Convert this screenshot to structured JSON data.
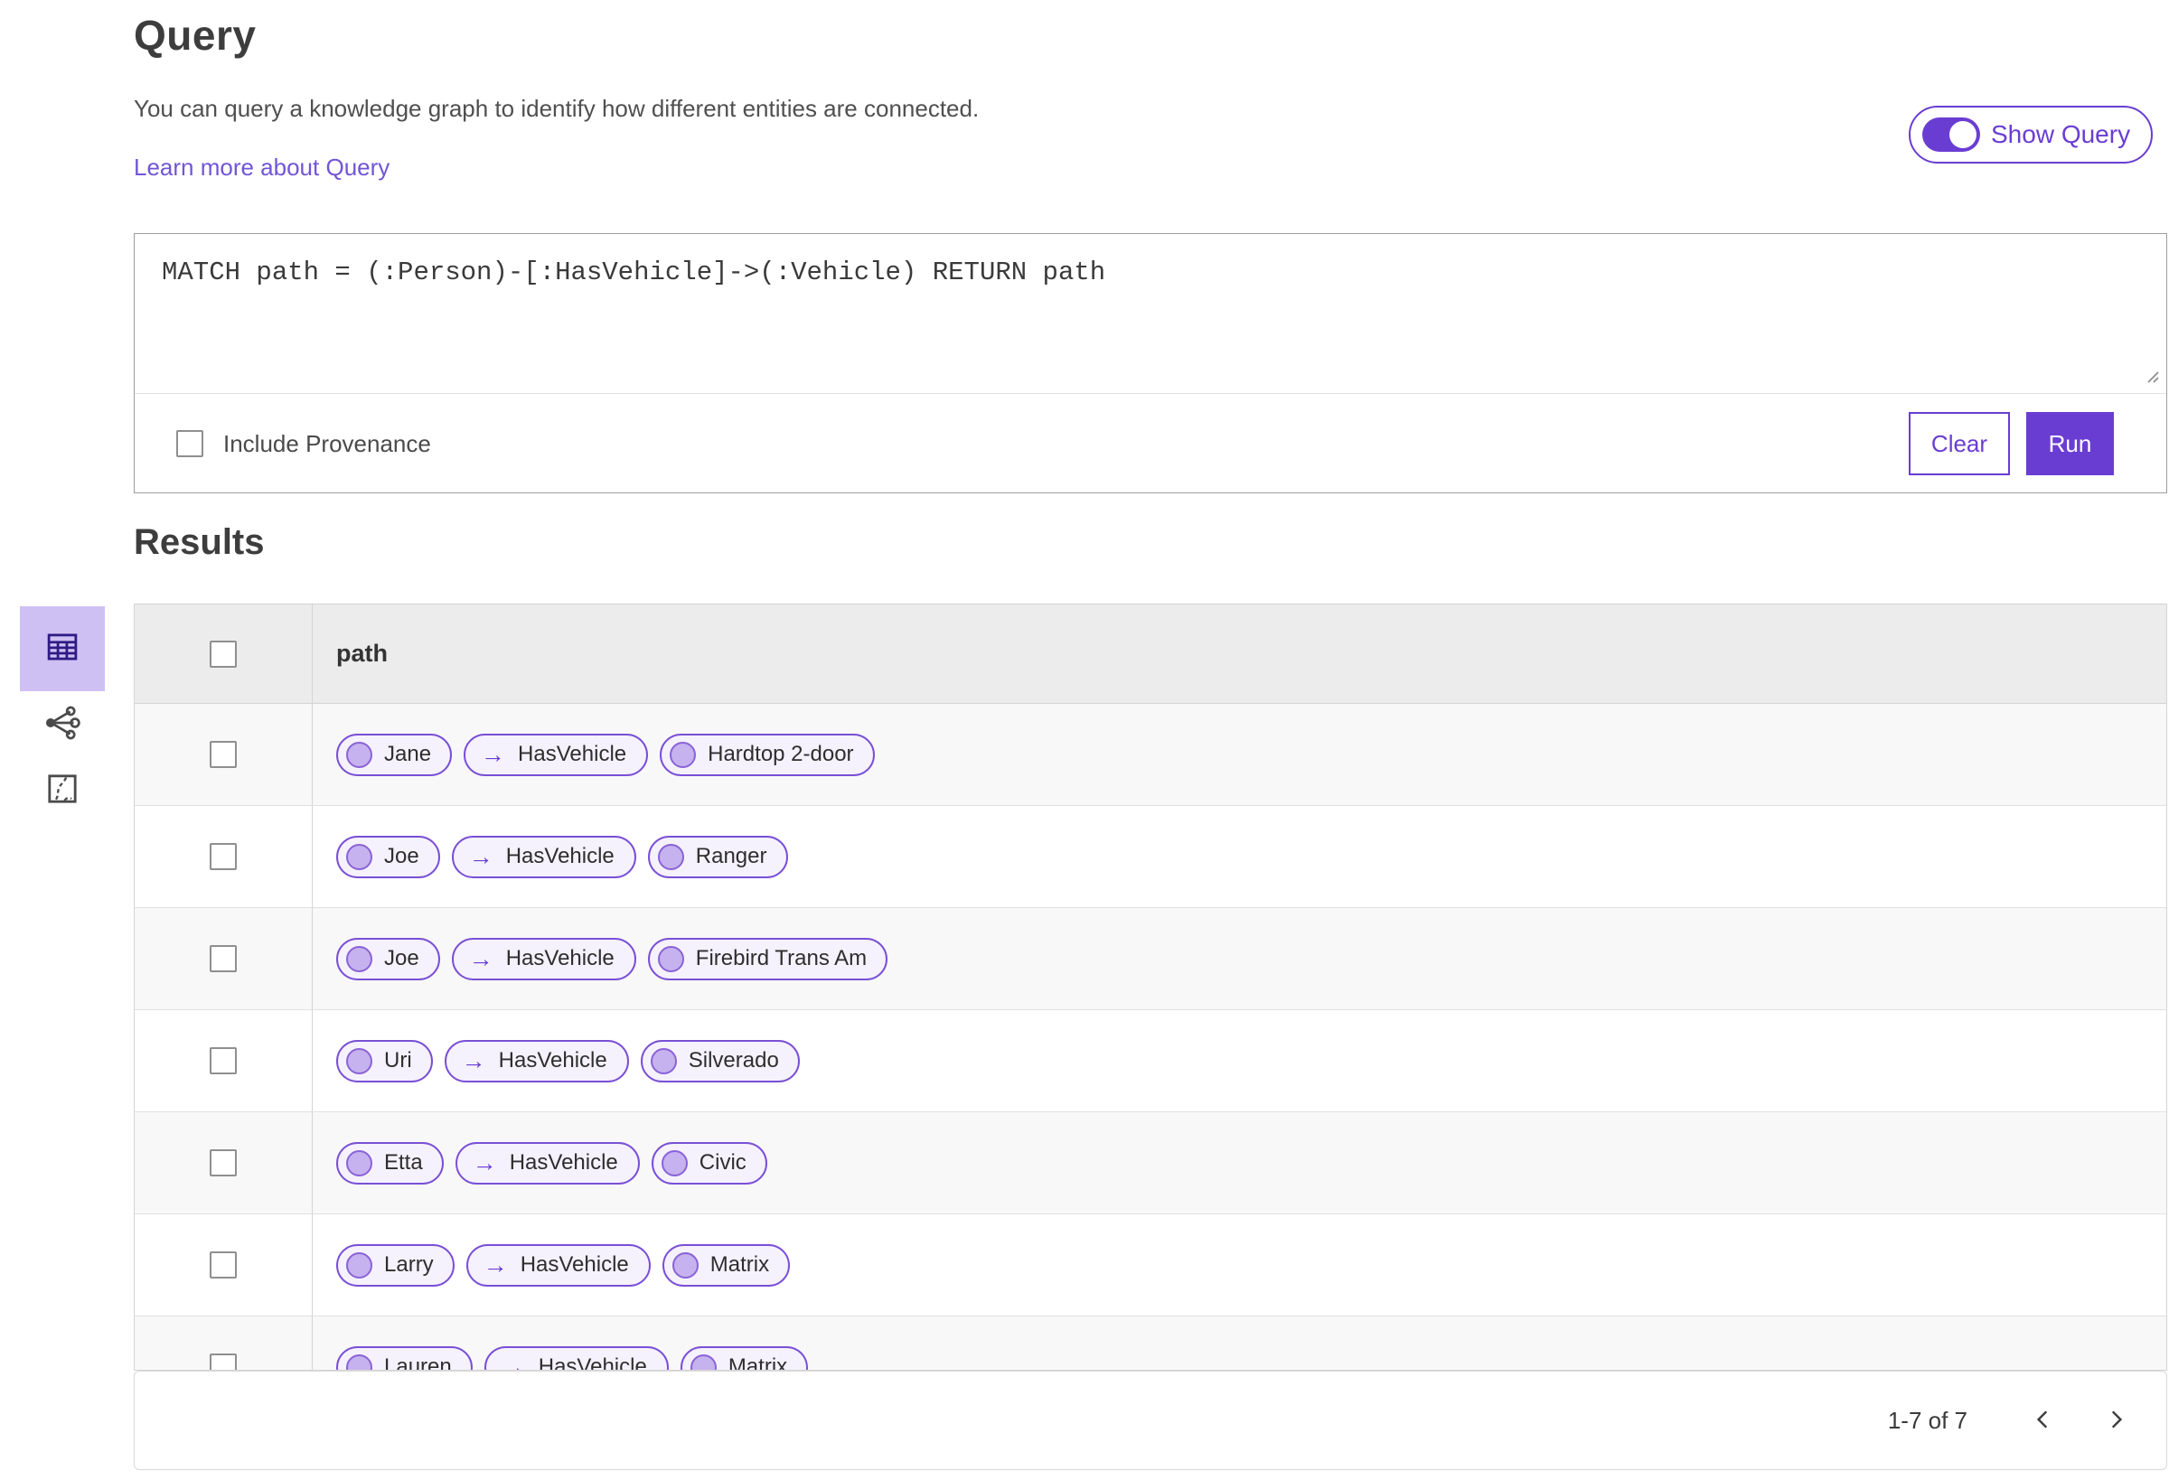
{
  "query_section": {
    "title": "Query",
    "description": "You can query a knowledge graph to identify how different entities are connected.",
    "learn_more_link": "Learn more about Query",
    "show_query_toggle": {
      "label": "Show Query",
      "on": true
    },
    "editor": {
      "query_text": "MATCH path = (:Person)-[:HasVehicle]->(:Vehicle) RETURN path"
    },
    "include_provenance": {
      "label": "Include Provenance",
      "checked": false
    },
    "buttons": {
      "clear": "Clear",
      "run": "Run"
    }
  },
  "results_section": {
    "title": "Results",
    "view_switcher": [
      {
        "name": "table-view",
        "selected": true
      },
      {
        "name": "link-chart-view",
        "selected": false
      },
      {
        "name": "map-view",
        "selected": false
      }
    ],
    "table": {
      "columns": [
        "path"
      ],
      "select_all_checked": false,
      "rows": [
        {
          "checked": false,
          "path": [
            {
              "type": "node",
              "label": "Jane"
            },
            {
              "type": "relationship",
              "label": "HasVehicle"
            },
            {
              "type": "node",
              "label": "Hardtop 2-door"
            }
          ]
        },
        {
          "checked": false,
          "path": [
            {
              "type": "node",
              "label": "Joe"
            },
            {
              "type": "relationship",
              "label": "HasVehicle"
            },
            {
              "type": "node",
              "label": "Ranger"
            }
          ]
        },
        {
          "checked": false,
          "path": [
            {
              "type": "node",
              "label": "Joe"
            },
            {
              "type": "relationship",
              "label": "HasVehicle"
            },
            {
              "type": "node",
              "label": "Firebird Trans Am"
            }
          ]
        },
        {
          "checked": false,
          "path": [
            {
              "type": "node",
              "label": "Uri"
            },
            {
              "type": "relationship",
              "label": "HasVehicle"
            },
            {
              "type": "node",
              "label": "Silverado"
            }
          ]
        },
        {
          "checked": false,
          "path": [
            {
              "type": "node",
              "label": "Etta"
            },
            {
              "type": "relationship",
              "label": "HasVehicle"
            },
            {
              "type": "node",
              "label": "Civic"
            }
          ]
        },
        {
          "checked": false,
          "path": [
            {
              "type": "node",
              "label": "Larry"
            },
            {
              "type": "relationship",
              "label": "HasVehicle"
            },
            {
              "type": "node",
              "label": "Matrix"
            }
          ]
        },
        {
          "checked": false,
          "path": [
            {
              "type": "node",
              "label": "Lauren"
            },
            {
              "type": "relationship",
              "label": "HasVehicle"
            },
            {
              "type": "node",
              "label": "Matrix"
            }
          ]
        }
      ]
    },
    "pagination": {
      "range_label": "1-7 of 7"
    }
  },
  "icons": {
    "relationship_arrow": "→"
  },
  "colors": {
    "accent": "#6a3dd2",
    "link": "#7255d6",
    "pill_border": "#7a4fd6",
    "pill_bg": "#f5f2fd",
    "node_fill": "#c6b2ee",
    "node_border": "#8a63d8",
    "sidebar_selected_bg": "#cfc0f3",
    "sidebar_selected_icon": "#2e1b85"
  }
}
